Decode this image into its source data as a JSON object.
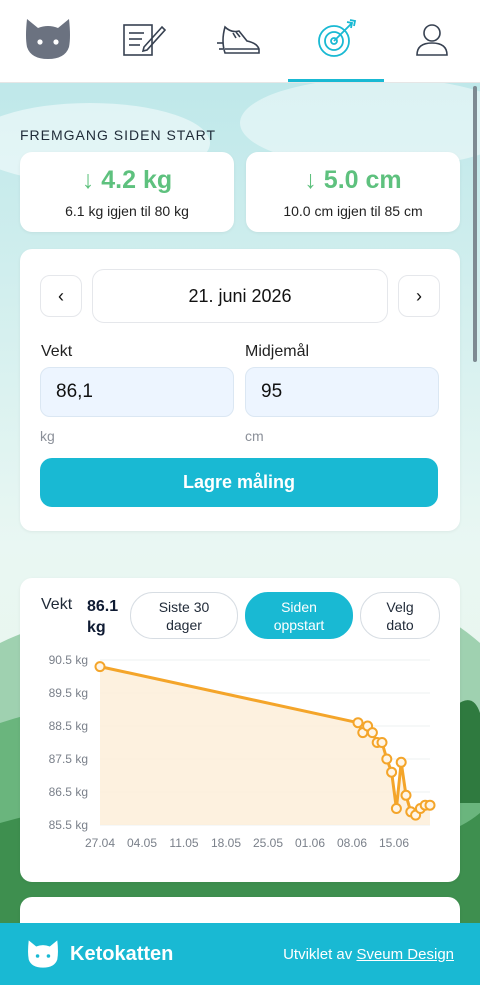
{
  "nav": {
    "items": [
      {
        "id": "cat",
        "icon": "cat-icon",
        "active": false
      },
      {
        "id": "log",
        "icon": "notepad-icon",
        "active": false
      },
      {
        "id": "activity",
        "icon": "sneaker-icon",
        "active": false
      },
      {
        "id": "goals",
        "icon": "target-icon",
        "active": true
      },
      {
        "id": "profile",
        "icon": "user-icon",
        "active": false
      }
    ]
  },
  "progress": {
    "title": "FREMGANG SIDEN START",
    "weight": {
      "change": "↓ 4.2 kg",
      "remaining": "6.1 kg igjen til 80 kg"
    },
    "waist": {
      "change": "↓ 5.0 cm",
      "remaining": "10.0 cm igjen til 85 cm"
    }
  },
  "entry": {
    "prev": "‹",
    "next": "›",
    "date": "21. juni 2026",
    "weight_label": "Vekt",
    "weight_value": "86,1",
    "weight_unit": "kg",
    "waist_label": "Midjemål",
    "waist_value": "95",
    "waist_unit": "cm",
    "save_label": "Lagre måling"
  },
  "chart_panel": {
    "label": "Vekt",
    "current_line1": "86.1",
    "current_line2": "kg",
    "filters": [
      {
        "line1": "Siste 30",
        "line2": "dager",
        "active": false
      },
      {
        "line1": "Siden",
        "line2": "oppstart",
        "active": true
      },
      {
        "line1": "Velg",
        "line2": "dato",
        "active": false
      }
    ]
  },
  "chart_data": {
    "type": "area",
    "ylim": [
      85.5,
      90.5
    ],
    "y_ticks": [
      "90.5 kg",
      "89.5 kg",
      "88.5 kg",
      "87.5 kg",
      "86.5 kg",
      "85.5 kg"
    ],
    "y_tick_values": [
      90.5,
      89.5,
      88.5,
      87.5,
      86.5,
      85.5
    ],
    "x_ticks": [
      "27.04",
      "04.05",
      "11.05",
      "18.05",
      "25.05",
      "01.06",
      "08.06",
      "15.06"
    ],
    "x_tick_days": [
      0,
      7,
      14,
      21,
      28,
      35,
      42,
      49
    ],
    "series": [
      {
        "x_days": [
          0,
          43,
          43.8,
          44.6,
          45.4,
          46.2,
          47,
          47.8,
          48.6,
          49.4,
          50.2,
          51,
          51.8,
          52.6,
          53.4,
          54.2,
          55
        ],
        "values": [
          90.3,
          88.6,
          88.3,
          88.5,
          88.3,
          88.0,
          88.0,
          87.5,
          87.1,
          86.0,
          87.4,
          86.4,
          85.9,
          85.8,
          86.0,
          86.1,
          86.1
        ],
        "color": "#f4a52a"
      }
    ]
  },
  "footer": {
    "brand": "Ketokatten",
    "credit_prefix": "Utviklet av",
    "credit_link": "Sveum Design"
  }
}
